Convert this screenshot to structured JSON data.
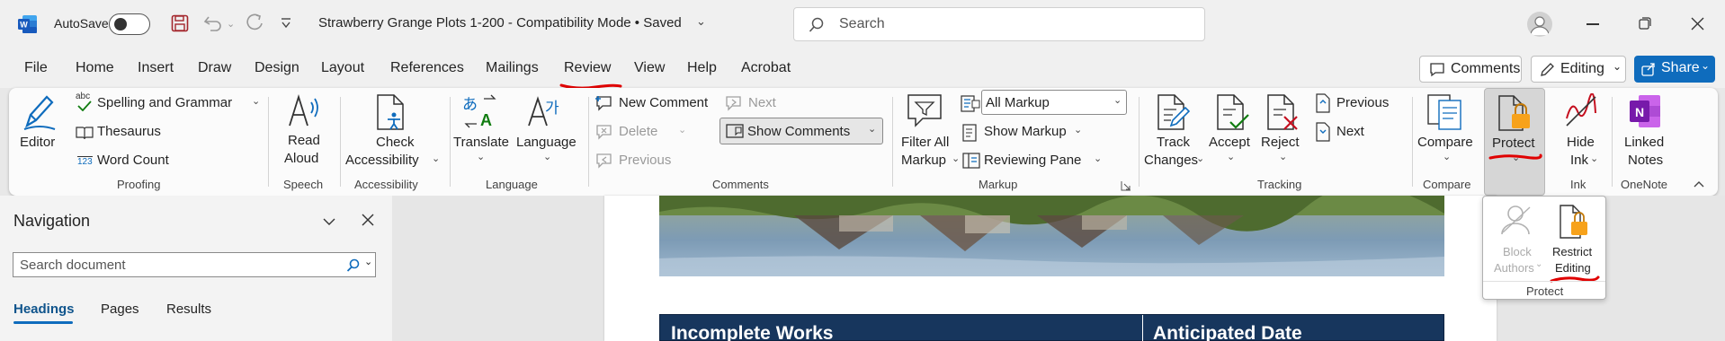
{
  "titlebar": {
    "autosave_label": "AutoSave",
    "autosave_state": "Off",
    "doc_title": "Strawberry Grange Plots 1-200  -  Compatibility Mode • Saved",
    "search_placeholder": "Search"
  },
  "menu": {
    "tabs": [
      "File",
      "Home",
      "Insert",
      "Draw",
      "Design",
      "Layout",
      "References",
      "Mailings",
      "Review",
      "View",
      "Help",
      "Acrobat"
    ],
    "active_tab": "Review",
    "comments_btn": "Comments",
    "editing_btn": "Editing",
    "share_btn": "Share"
  },
  "ribbon": {
    "proofing": {
      "editor": "Editor",
      "spelling": "Spelling and Grammar",
      "thesaurus": "Thesaurus",
      "word_count": "Word Count",
      "abc_small": "abc",
      "count_small": "123",
      "group": "Proofing"
    },
    "speech": {
      "read_aloud_1": "Read",
      "read_aloud_2": "Aloud",
      "group": "Speech"
    },
    "accessibility": {
      "check_1": "Check",
      "check_2": "Accessibility",
      "group": "Accessibility"
    },
    "language": {
      "translate": "Translate",
      "language": "Language",
      "group": "Language"
    },
    "comments": {
      "new": "New Comment",
      "delete": "Delete",
      "previous": "Previous",
      "next": "Next",
      "show": "Show Comments",
      "group": "Comments"
    },
    "markup": {
      "filter_1": "Filter All",
      "filter_2": "Markup",
      "dropdown": "All Markup",
      "show_markup": "Show Markup",
      "reviewing_pane": "Reviewing Pane",
      "group": "Markup"
    },
    "tracking": {
      "track_1": "Track",
      "track_2": "Changes",
      "accept": "Accept",
      "reject": "Reject",
      "previous": "Previous",
      "next": "Next",
      "group": "Tracking"
    },
    "compare": {
      "compare": "Compare",
      "group": "Compare"
    },
    "protect": {
      "protect": "Protect"
    },
    "ink": {
      "hide_1": "Hide",
      "hide_2": "Ink",
      "group": "Ink"
    },
    "onenote": {
      "linked_1": "Linked",
      "linked_2": "Notes",
      "group": "OneNote"
    }
  },
  "protect_menu": {
    "block_1": "Block",
    "block_2": "Authors",
    "restrict_1": "Restrict",
    "restrict_2": "Editing",
    "group": "Protect"
  },
  "navigation": {
    "title": "Navigation",
    "search_placeholder": "Search document",
    "tabs": [
      "Headings",
      "Pages",
      "Results"
    ],
    "active_tab": "Headings"
  },
  "document": {
    "table_header_1": "Incomplete Works",
    "table_header_2": "Anticipated Date"
  },
  "colors": {
    "accent": "#0f6cbd",
    "annotation_red": "#e00000",
    "table_header_bg": "#17365d"
  }
}
